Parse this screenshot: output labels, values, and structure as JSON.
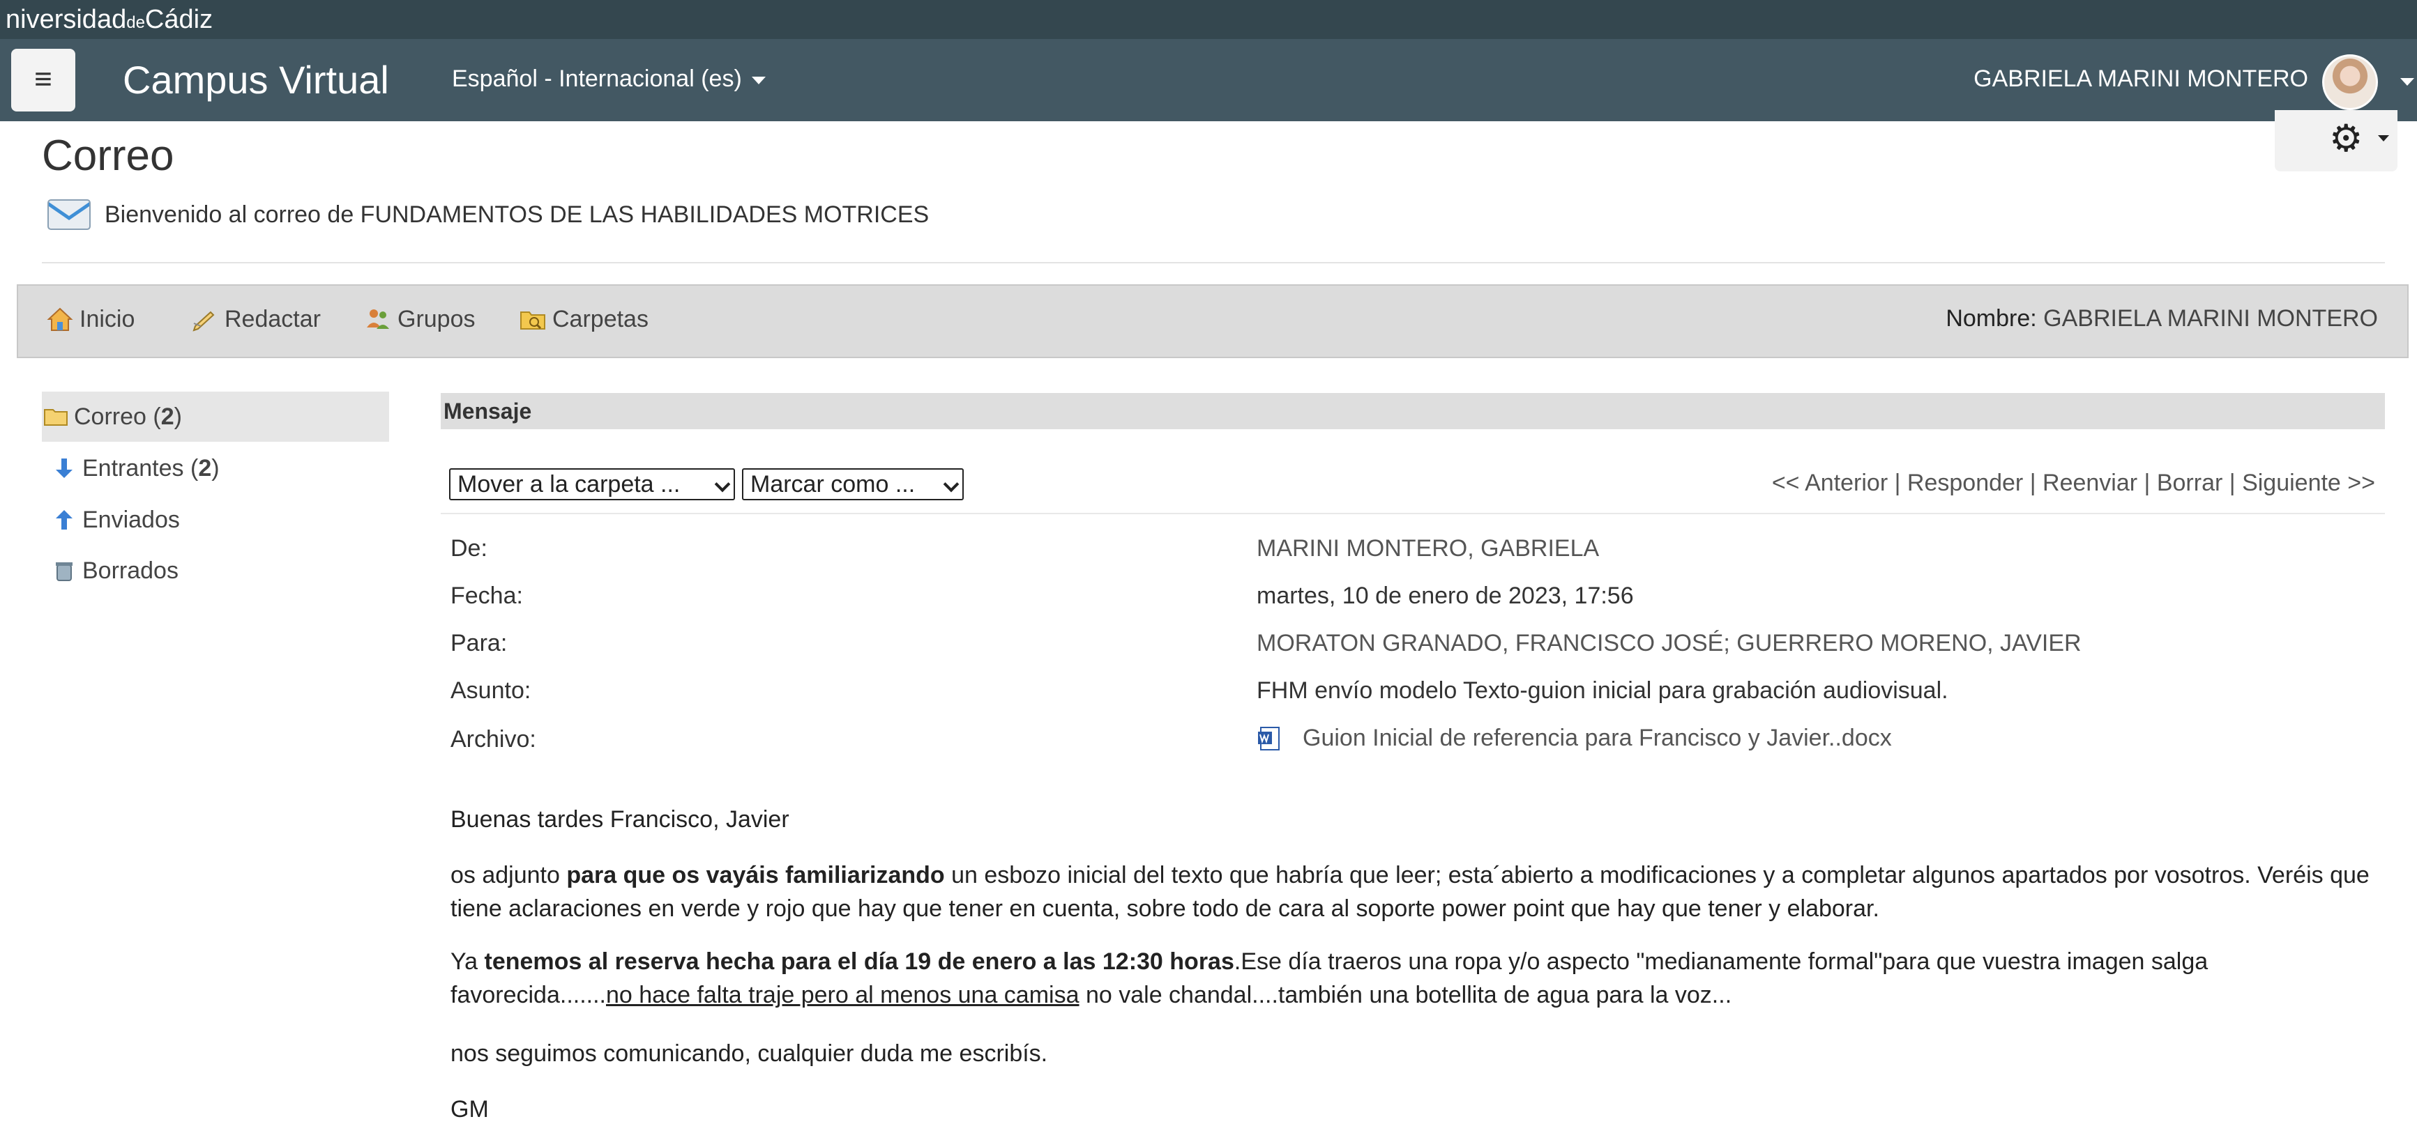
{
  "brand": {
    "text_pre": "niversidad",
    "text_de": "de",
    "text_post": "Cádiz"
  },
  "navbar": {
    "menu_icon": "hamburger-icon",
    "site_title": "Campus Virtual",
    "language": "Español - Internacional (es)",
    "user_name": "GABRIELA MARINI MONTERO"
  },
  "page": {
    "title": "Correo",
    "welcome": "Bienvenido al correo de FUNDAMENTOS DE LAS HABILIDADES MOTRICES"
  },
  "toolbar": {
    "items": [
      {
        "label": "Inicio",
        "icon": "home-icon"
      },
      {
        "label": "Redactar",
        "icon": "compose-icon"
      },
      {
        "label": "Grupos",
        "icon": "groups-icon"
      },
      {
        "label": "Carpetas",
        "icon": "folders-icon"
      }
    ],
    "name_label": "Nombre:",
    "name_value": "GABRIELA MARINI MONTERO"
  },
  "sidebar": {
    "items": [
      {
        "label": "Correo (",
        "count": "2",
        "suffix": ")",
        "icon": "folder-icon"
      },
      {
        "label": "Entrantes (",
        "count": "2",
        "suffix": ")",
        "icon": "arrow-down-icon"
      },
      {
        "label": "Enviados",
        "icon": "arrow-up-icon"
      },
      {
        "label": "Borrados",
        "icon": "trash-icon"
      }
    ]
  },
  "message": {
    "header": "Mensaje",
    "move_select": "Mover a la carpeta ...",
    "mark_select": "Marcar como ...",
    "nav": {
      "prev": "<< Anterior",
      "reply": "Responder",
      "forward": "Reenviar",
      "delete": "Borrar",
      "next": "Siguiente >>",
      "separator": "|"
    },
    "fields": {
      "from_label": "De:",
      "from_value": "MARINI MONTERO, GABRIELA",
      "date_label": "Fecha:",
      "date_value": "martes, 10 de enero de 2023, 17:56",
      "to_label": "Para:",
      "to_value": "MORATON GRANADO, FRANCISCO JOSÉ; GUERRERO MORENO, JAVIER",
      "subject_label": "Asunto:",
      "subject_value": "FHM envío modelo Texto-guion inicial para grabación audiovisual.",
      "attachment_label": "Archivo:",
      "attachment_value": "Guion Inicial de referencia para Francisco y Javier..docx"
    },
    "body": {
      "greeting": "Buenas tardes Francisco, Javier",
      "p1_a": "os adjunto ",
      "p1_b": "para que os vayáis familiarizando",
      "p1_c": " un esbozo inicial  del texto que habría que leer; esta´abierto a modificaciones y a completar algunos apartados por vosotros. Veréis que tiene aclaraciones en verde y rojo que hay que  tener en cuenta, sobre todo de cara al soporte power point que hay que tener y elaborar.",
      "p2_a": "Ya ",
      "p2_b": "tenemos al reserva hecha para el día 19 de enero a las 12:30 horas",
      "p2_c": ".Ese día traeros una ropa y/o aspecto  \"medianamente formal\"para  que vuestra imagen salga favorecida.......",
      "p2_d": "no hace falta traje pero al menos una camisa",
      "p2_e": " no vale chandal....también una botellita de agua para la voz...",
      "p3": "nos seguimos comunicando, cualquier duda me escribís.",
      "signature": "GM"
    }
  }
}
